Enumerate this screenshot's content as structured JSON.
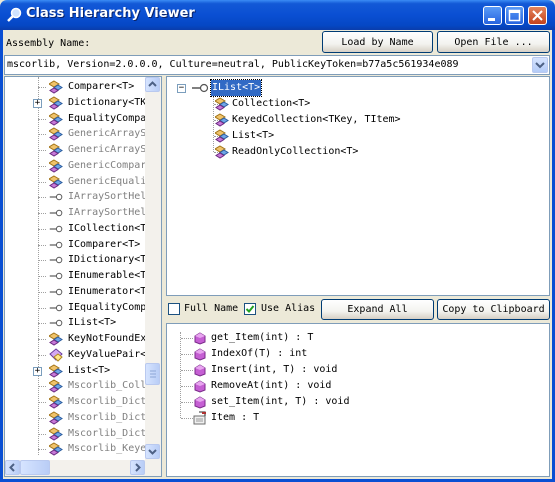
{
  "window": {
    "title": "Class Hierarchy Viewer"
  },
  "assembly": {
    "label": "Assembly Name:",
    "load_by_name": "Load by Name",
    "open_file": "Open File ...",
    "value": "mscorlib, Version=2.0.0.0, Culture=neutral, PublicKeyToken=b77a5c561934e089"
  },
  "left_tree": [
    {
      "label": "Comparer<T>",
      "gray": false,
      "icon": "class",
      "expander": false
    },
    {
      "label": "Dictionary<TK",
      "gray": false,
      "icon": "class",
      "expander": true
    },
    {
      "label": "EqualityCompa",
      "gray": false,
      "icon": "class",
      "expander": false
    },
    {
      "label": "GenericArrayS",
      "gray": true,
      "icon": "class",
      "expander": false
    },
    {
      "label": "GenericArrayS",
      "gray": true,
      "icon": "class",
      "expander": false
    },
    {
      "label": "GenericCompar",
      "gray": true,
      "icon": "class",
      "expander": false
    },
    {
      "label": "GenericEquali",
      "gray": true,
      "icon": "class",
      "expander": false
    },
    {
      "label": "IArraySortHel",
      "gray": true,
      "icon": "interface",
      "expander": false
    },
    {
      "label": "IArraySortHel",
      "gray": true,
      "icon": "interface",
      "expander": false
    },
    {
      "label": "ICollection<T",
      "gray": false,
      "icon": "interface",
      "expander": false
    },
    {
      "label": "IComparer<T>",
      "gray": false,
      "icon": "interface",
      "expander": false
    },
    {
      "label": "IDictionary<T",
      "gray": false,
      "icon": "interface",
      "expander": false
    },
    {
      "label": "IEnumerable<T",
      "gray": false,
      "icon": "interface",
      "expander": false
    },
    {
      "label": "IEnumerator<T",
      "gray": false,
      "icon": "interface",
      "expander": false
    },
    {
      "label": "IEqualityComp",
      "gray": false,
      "icon": "interface",
      "expander": false
    },
    {
      "label": "IList<T>",
      "gray": false,
      "icon": "interface",
      "expander": false
    },
    {
      "label": "KeyNotFoundEx",
      "gray": false,
      "icon": "class",
      "expander": false
    },
    {
      "label": "KeyValuePair<",
      "gray": false,
      "icon": "struct",
      "expander": false
    },
    {
      "label": "List<T>",
      "gray": false,
      "icon": "class",
      "expander": true
    },
    {
      "label": "Mscorlib_Coll",
      "gray": true,
      "icon": "class",
      "expander": false
    },
    {
      "label": "Mscorlib_Dict",
      "gray": true,
      "icon": "class",
      "expander": false
    },
    {
      "label": "Mscorlib_Dict",
      "gray": true,
      "icon": "class",
      "expander": false
    },
    {
      "label": "Mscorlib_Dict",
      "gray": true,
      "icon": "class",
      "expander": false
    },
    {
      "label": "Mscorlib_Keye",
      "gray": true,
      "icon": "class",
      "expander": false
    }
  ],
  "hierarchy": {
    "root": "IList<T>",
    "children": [
      "Collection<T>",
      "KeyedCollection<TKey, TItem>",
      "List<T>",
      "ReadOnlyCollection<T>"
    ]
  },
  "options": {
    "full_name": "Full Name",
    "full_name_checked": false,
    "use_alias": "Use Alias",
    "use_alias_checked": true,
    "expand_all": "Expand All",
    "copy": "Copy to Clipboard"
  },
  "members": [
    {
      "label": "get_Item(int) : T",
      "icon": "method"
    },
    {
      "label": "IndexOf(T) : int",
      "icon": "method"
    },
    {
      "label": "Insert(int, T) : void",
      "icon": "method"
    },
    {
      "label": "RemoveAt(int) : void",
      "icon": "method"
    },
    {
      "label": "set_Item(int, T) : void",
      "icon": "method"
    },
    {
      "label": "Item : T",
      "icon": "property"
    }
  ],
  "colors": {
    "titlebar": "#0a4fd3",
    "selection": "#316ac5",
    "window_bg": "#ece9d8"
  }
}
